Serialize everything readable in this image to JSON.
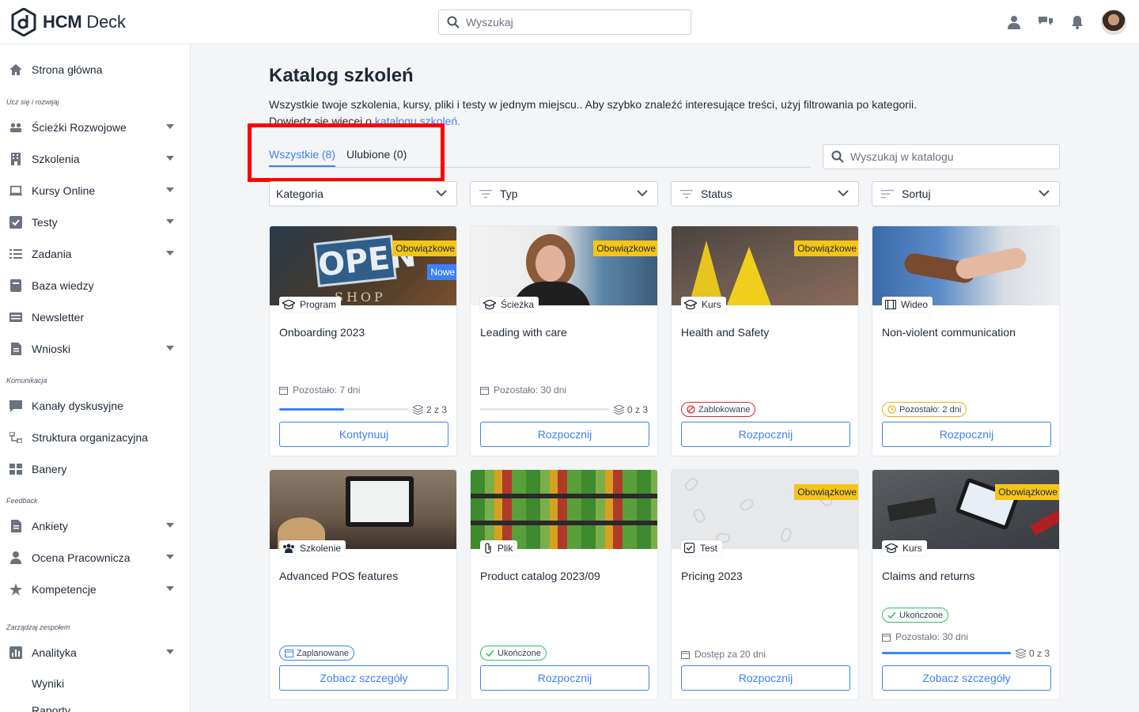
{
  "app": {
    "brand_bold": "HCM",
    "brand_rest": " Deck"
  },
  "topbar": {
    "search_placeholder": "Wyszukaj"
  },
  "sidebar": {
    "home": "Strona główna",
    "section_learn": "Ucz się i rozwijaj",
    "paths": "Ścieżki Rozwojowe",
    "trainings": "Szkolenia",
    "online_courses": "Kursy Online",
    "tests": "Testy",
    "tasks": "Zadania",
    "knowledge": "Baza wiedzy",
    "newsletter": "Newsletter",
    "requests": "Wnioski",
    "section_comm": "Komunikacja",
    "channels": "Kanały dyskusyjne",
    "org": "Struktura organizacyjna",
    "banners": "Banery",
    "section_feedback": "Feedback",
    "surveys": "Ankiety",
    "review": "Ocena Pracownicza",
    "competences": "Kompetencje",
    "section_team": "Zarządzaj zespołem",
    "analytics": "Analityka",
    "results": "Wyniki",
    "reports": "Raporty"
  },
  "main": {
    "title": "Katalog szkoleń",
    "desc": "Wszystkie twoje szkolenia, kursy, pliki i testy w jednym miejscu.. Aby szybko znaleźć interesujące treści, użyj filtrowania po kategorii.",
    "desc2_prefix": "Dowiedz się więcej o ",
    "desc2_link": "katalogu szkoleń.",
    "tab_all": "Wszystkie (8)",
    "tab_fav": "Ulubione (0)",
    "catalog_search_placeholder": "Wyszukaj w katalogu",
    "filter_category": "Kategoria",
    "filter_type": "Typ",
    "filter_status": "Status",
    "filter_sort": "Sortuj"
  },
  "cards": [
    {
      "title": "Onboarding 2023",
      "type": "Program",
      "required": "Obowiązkowe",
      "new": "Nowe",
      "meta": "Pozostało: 7 dni",
      "progress_text": "2 z 3",
      "progress": 0.5,
      "button": "Kontynuuj"
    },
    {
      "title": "Leading with care",
      "type": "Ścieżka",
      "required": "Obowiązkowe",
      "meta": "Pozostało: 30 dni",
      "progress_text": "0 z 3",
      "progress": 0,
      "button": "Rozpocznij"
    },
    {
      "title": "Health and Safety",
      "type": "Kurs",
      "required": "Obowiązkowe",
      "status": "Zablokowane",
      "button": "Rozpocznij"
    },
    {
      "title": "Non-violent communication",
      "type": "Wideo",
      "status": "Pozostało: 2 dni",
      "button": "Rozpocznij"
    },
    {
      "title": "Advanced POS features",
      "type": "Szkolenie",
      "status": "Zaplanowane",
      "button": "Zobacz szczegóły"
    },
    {
      "title": "Product catalog 2023/09",
      "type": "Plik",
      "status": "Ukończone",
      "button": "Rozpocznij"
    },
    {
      "title": "Pricing 2023",
      "type": "Test",
      "required": "Obowiązkowe",
      "meta": "Dostęp za 20 dni",
      "button": "Rozpocznij"
    },
    {
      "title": "Claims and returns",
      "type": "Kurs",
      "required": "Obowiązkowe",
      "status": "Ukończone",
      "meta": "Pozostało: 30 dni",
      "progress_text": "0 z 3",
      "progress": 1.0,
      "button": "Zobacz szczegóły"
    }
  ],
  "colors": {
    "accent": "#3b82f6",
    "required": "#f5c518",
    "highlight": "#ff0000"
  }
}
